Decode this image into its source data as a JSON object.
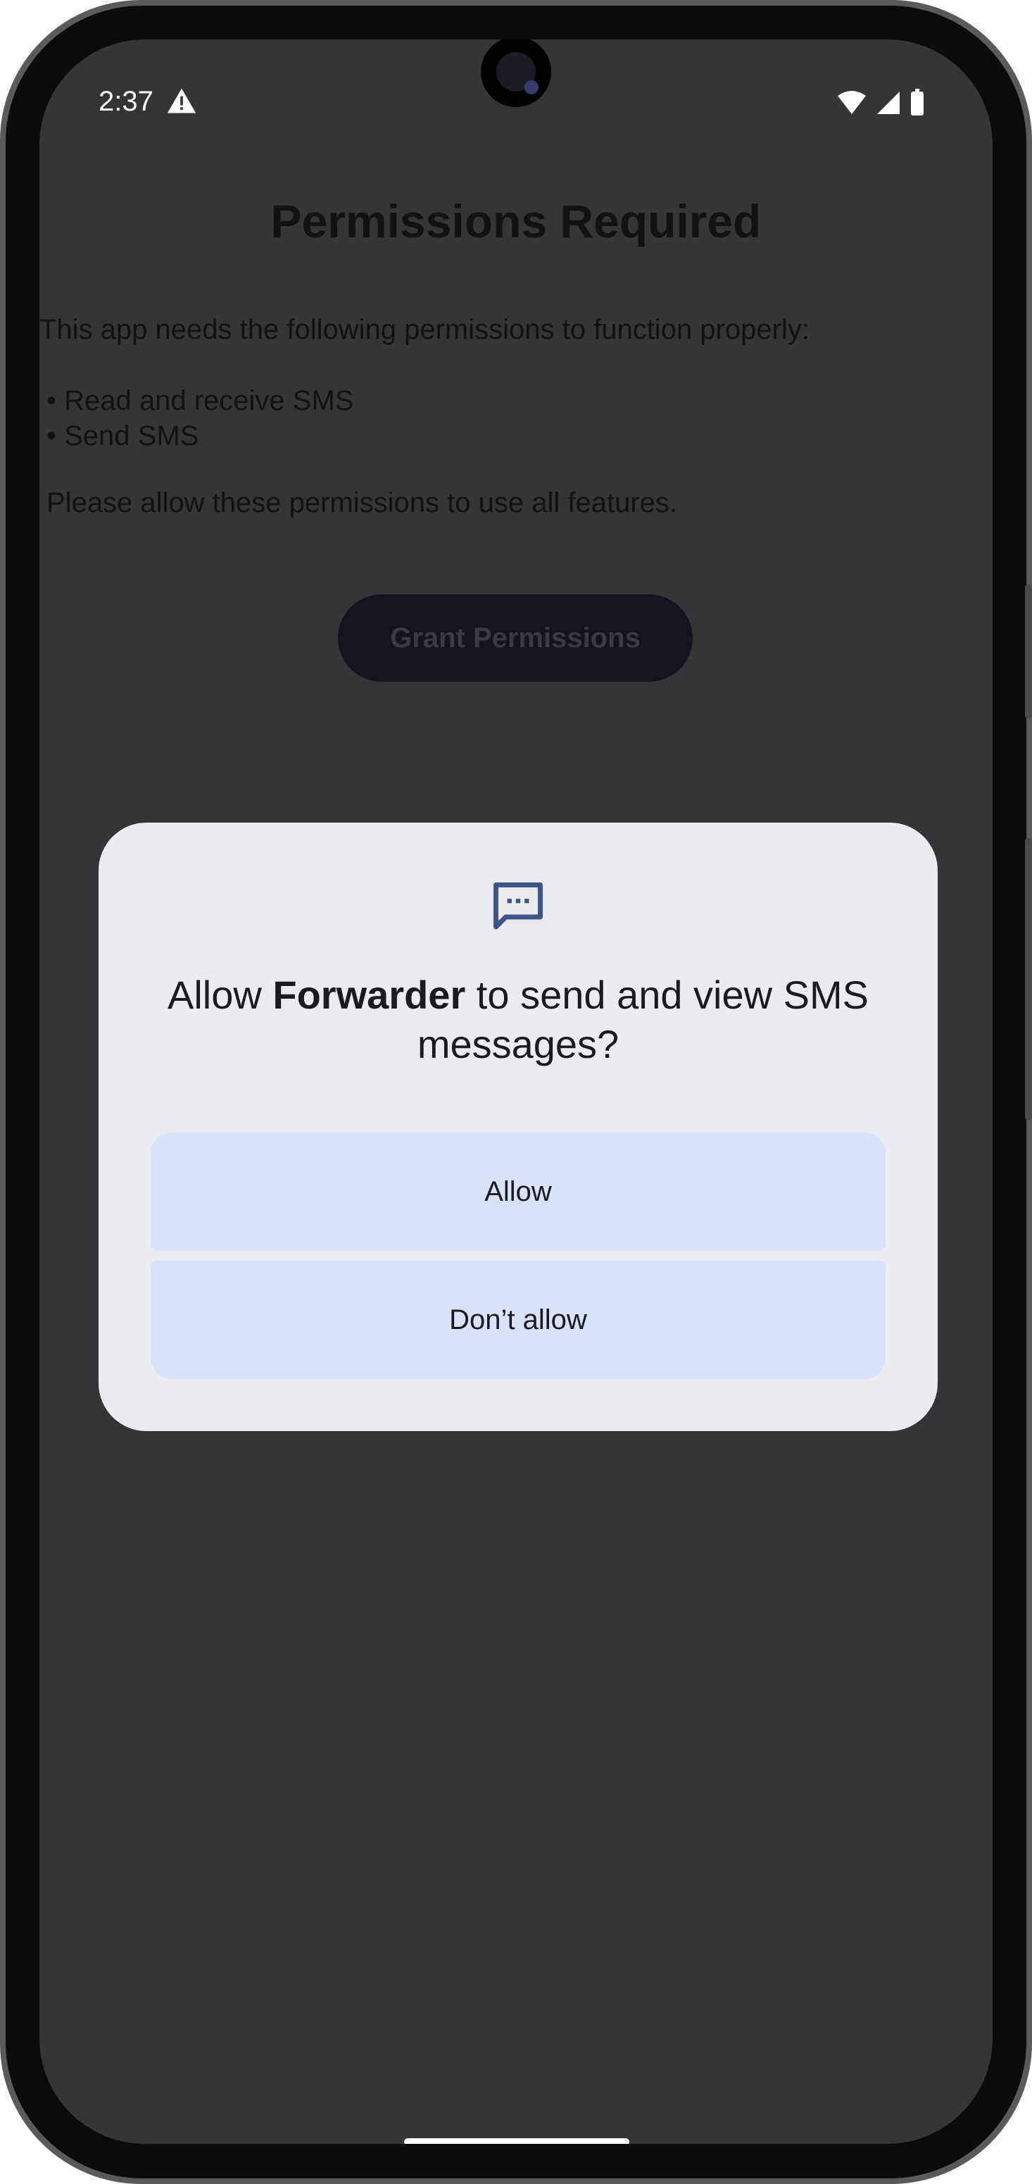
{
  "status_bar": {
    "time": "2:37"
  },
  "app": {
    "title": "Permissions Required",
    "intro": "This app needs the following permissions to function properly:",
    "bullets": [
      "Read and receive SMS",
      "Send SMS"
    ],
    "note": "Please allow these permissions to use all features.",
    "grant_button": "Grant Permissions"
  },
  "dialog": {
    "icon": "sms-icon",
    "title_prefix": "Allow ",
    "app_name": "Forwarder",
    "title_suffix": " to send and view SMS messages?",
    "allow_label": "Allow",
    "deny_label": "Don’t allow"
  },
  "colors": {
    "scrim_background": "#353437",
    "dialog_background": "#ecebf1",
    "dialog_button": "#d9e1fb",
    "icon_accent": "#3f5587"
  }
}
